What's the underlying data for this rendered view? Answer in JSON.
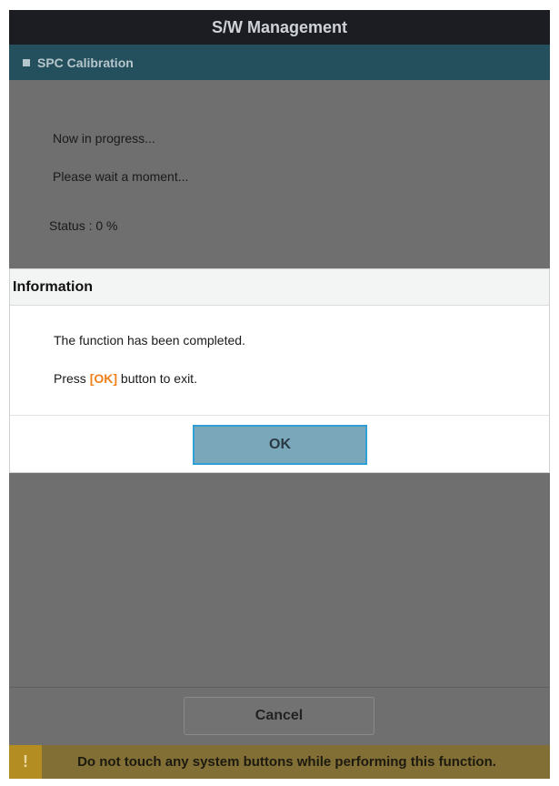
{
  "window": {
    "title": "S/W Management"
  },
  "subheader": {
    "label": "SPC Calibration",
    "icon": "square-bullet-icon"
  },
  "progress": {
    "line1": "Now in progress...",
    "line2": "Please wait a moment...",
    "status": "Status : 0 %"
  },
  "dialog": {
    "title": "Information",
    "line1": "The function has been completed.",
    "line2_prefix": "Press ",
    "line2_highlight": "[OK]",
    "line2_suffix": " button to exit.",
    "ok_label": "OK"
  },
  "footer": {
    "cancel_label": "Cancel"
  },
  "warning": {
    "icon": "exclamation-icon",
    "symbol": "!",
    "text": "Do not touch any system buttons while performing this function."
  },
  "colors": {
    "accent_orange": "#f07f1a",
    "ok_border": "#2f9fd6",
    "header": "#244f5c",
    "warning": "#826f35"
  }
}
